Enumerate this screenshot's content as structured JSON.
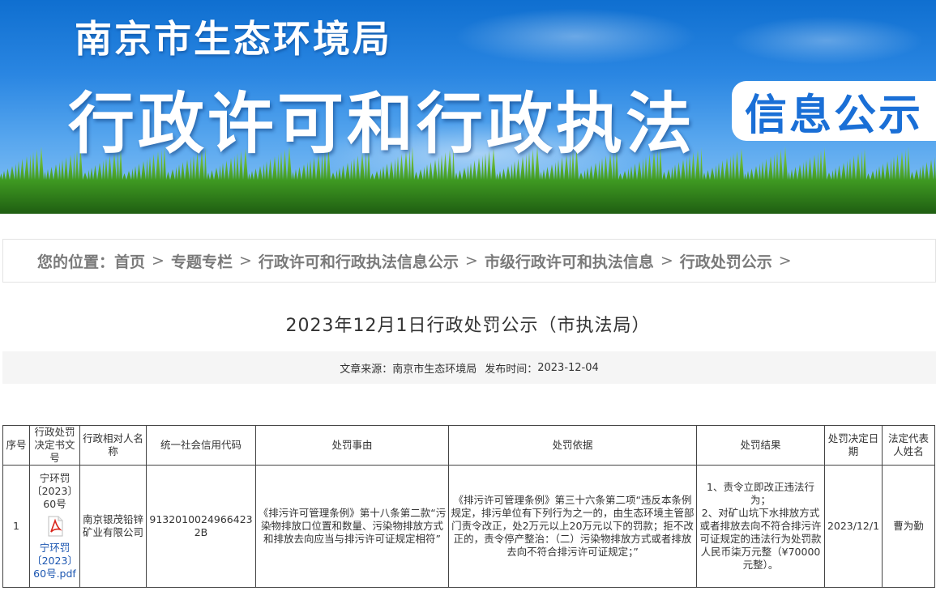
{
  "banner": {
    "org": "南京市生态环境局",
    "main_title": "行政许可和行政执法",
    "badge": "信息公示"
  },
  "breadcrumb": {
    "prefix": "您的位置：",
    "items": [
      "首页",
      "专题专栏",
      "行政许可和行政执法信息公示",
      "市级行政许可和执法信息",
      "行政处罚公示"
    ],
    "separator": ">"
  },
  "article": {
    "title": "2023年12月1日行政处罚公示（市执法局）",
    "source_label": "文章来源：",
    "source": "南京市生态环境局",
    "date_label": "发布时间：",
    "date": "2023-12-04"
  },
  "table": {
    "headers": [
      "序号",
      "行政处罚决定书文号",
      "行政相对人名称",
      "统一社会信用代码",
      "处罚事由",
      "处罚依据",
      "处罚结果",
      "处罚决定日期",
      "法定代表人姓名"
    ],
    "rows": [
      {
        "no": "1",
        "doc_no": "宁环罚〔2023〕60号",
        "attachment": "宁环罚〔2023〕60号.pdf",
        "party": "南京银茂铅锌矿业有限公司",
        "credit_code": "91320100249664232B",
        "reason": "《排污许可管理条例》第十八条第二款“污染物排放口位置和数量、污染物排放方式和排放去向应当与排污许可证规定相符”",
        "basis": "《排污许可管理条例》第三十六条第二项“违反本条例规定，排污单位有下列行为之一的，由生态环境主管部门责令改正，处2万元以上20万元以下的罚款；拒不改正的，责令停产整治：（二）污染物排放方式或者排放去向不符合排污许可证规定；”",
        "result": "1、责令立即改正违法行为；\n2、对矿山坑下水排放方式或者排放去向不符合排污许可证规定的违法行为处罚款人民币柒万元整（¥70000元整）。",
        "date": "2023/12/1",
        "legal_rep": "曹为勤"
      }
    ]
  }
}
